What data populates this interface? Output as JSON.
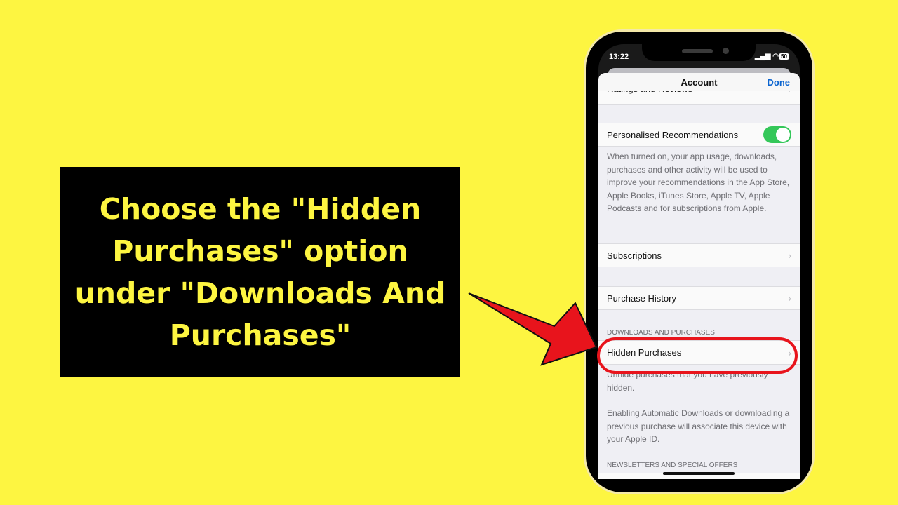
{
  "caption": "Choose the \"Hidden Purchases\" option under \"Downloads And Purchases\"",
  "status": {
    "time": "13:22",
    "battery": "50"
  },
  "header": {
    "title": "Account",
    "done": "Done"
  },
  "rows": {
    "ratings": "Ratings and Reviews",
    "personalised": "Personalised Recommendations",
    "subscriptions": "Subscriptions",
    "purchase_history": "Purchase History",
    "hidden_purchases": "Hidden Purchases"
  },
  "toggle_on": true,
  "personalised_footer": "When turned on, your app usage, downloads, purchases and other activity will be used to improve your recommendations in the App Store, Apple Books, iTunes Store, Apple TV, Apple Podcasts and for subscriptions from Apple.",
  "downloads_header": "DOWNLOADS AND PURCHASES",
  "hidden_footer": "Unhide purchases that you have previously hidden.",
  "auto_footer": "Enabling Automatic Downloads or downloading a previous purchase will associate this device with your Apple ID.",
  "newsletters_header": "NEWSLETTERS AND SPECIAL OFFERS",
  "colors": {
    "background": "#fdf541",
    "highlight": "#e8141c",
    "toggle": "#34c759",
    "link": "#0a64d0"
  }
}
